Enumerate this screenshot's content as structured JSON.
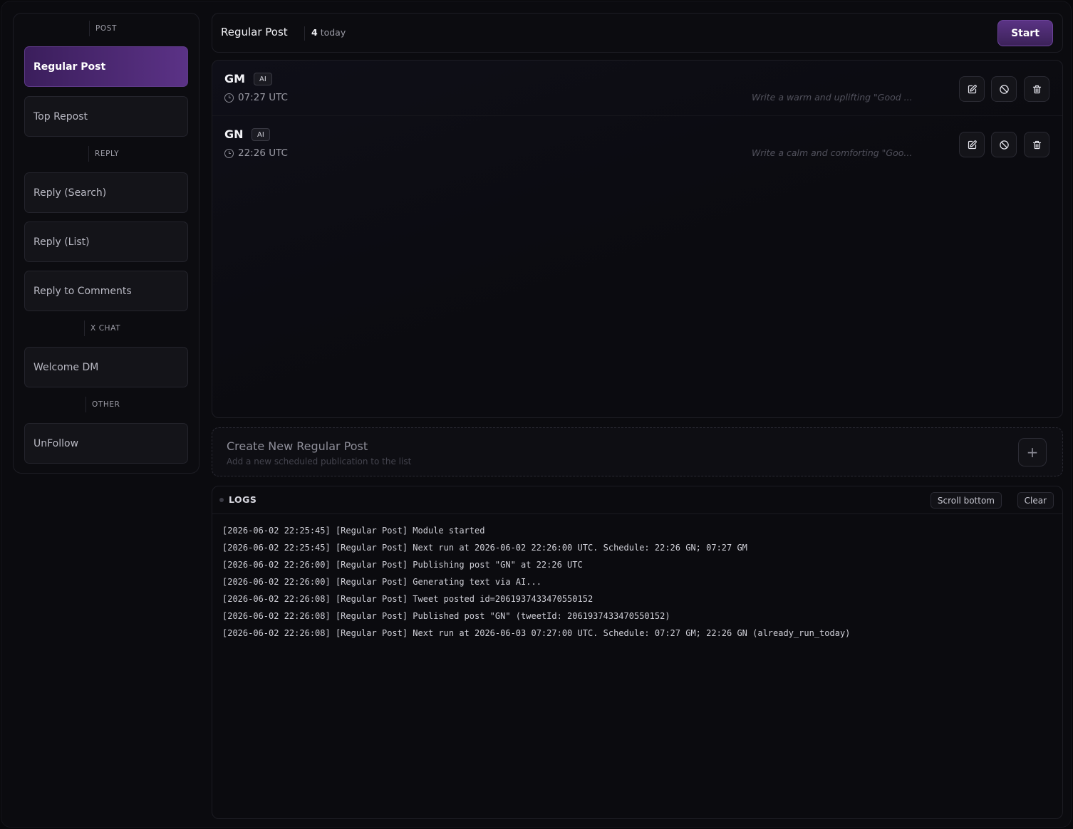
{
  "sidebar": {
    "sections": [
      {
        "label": "POST"
      },
      {
        "label": "REPLY"
      },
      {
        "label": "X CHAT"
      },
      {
        "label": "OTHER"
      }
    ],
    "items": [
      {
        "label": "Regular Post",
        "active": true
      },
      {
        "label": "Top Repost"
      },
      {
        "label": "Reply (Search)"
      },
      {
        "label": "Reply (List)"
      },
      {
        "label": "Reply to Comments"
      },
      {
        "label": "Welcome DM"
      },
      {
        "label": "UnFollow"
      }
    ]
  },
  "header": {
    "title": "Regular Post",
    "count": "4",
    "count_suffix": "today",
    "start_label": "Start"
  },
  "posts": [
    {
      "name": "GM",
      "badge": "AI",
      "time": "07:27 UTC",
      "prompt": "Write a warm and uplifting \"Good ..."
    },
    {
      "name": "GN",
      "badge": "AI",
      "time": "22:26 UTC",
      "prompt": "Write a calm and comforting \"Goo..."
    }
  ],
  "create": {
    "title": "Create New Regular Post",
    "subtitle": "Add a new scheduled publication to the list",
    "plus": "+"
  },
  "logs": {
    "title": "LOGS",
    "scroll_label": "Scroll bottom",
    "clear_label": "Clear",
    "lines": [
      "[2026-06-02 22:25:45] [Regular Post] Module started",
      "[2026-06-02 22:25:45] [Regular Post] Next run at 2026-06-02 22:26:00 UTC. Schedule: 22:26 GN; 07:27 GM",
      "[2026-06-02 22:26:00] [Regular Post] Publishing post \"GN\" at 22:26 UTC",
      "[2026-06-02 22:26:00] [Regular Post] Generating text via AI...",
      "[2026-06-02 22:26:08] [Regular Post] Tweet posted id=2061937433470550152",
      "[2026-06-02 22:26:08] [Regular Post] Published post \"GN\" (tweetId: 2061937433470550152)",
      "[2026-06-02 22:26:08] [Regular Post] Next run at 2026-06-03 07:27:00 UTC. Schedule: 07:27 GM; 22:26 GN (already_run_today)"
    ]
  }
}
